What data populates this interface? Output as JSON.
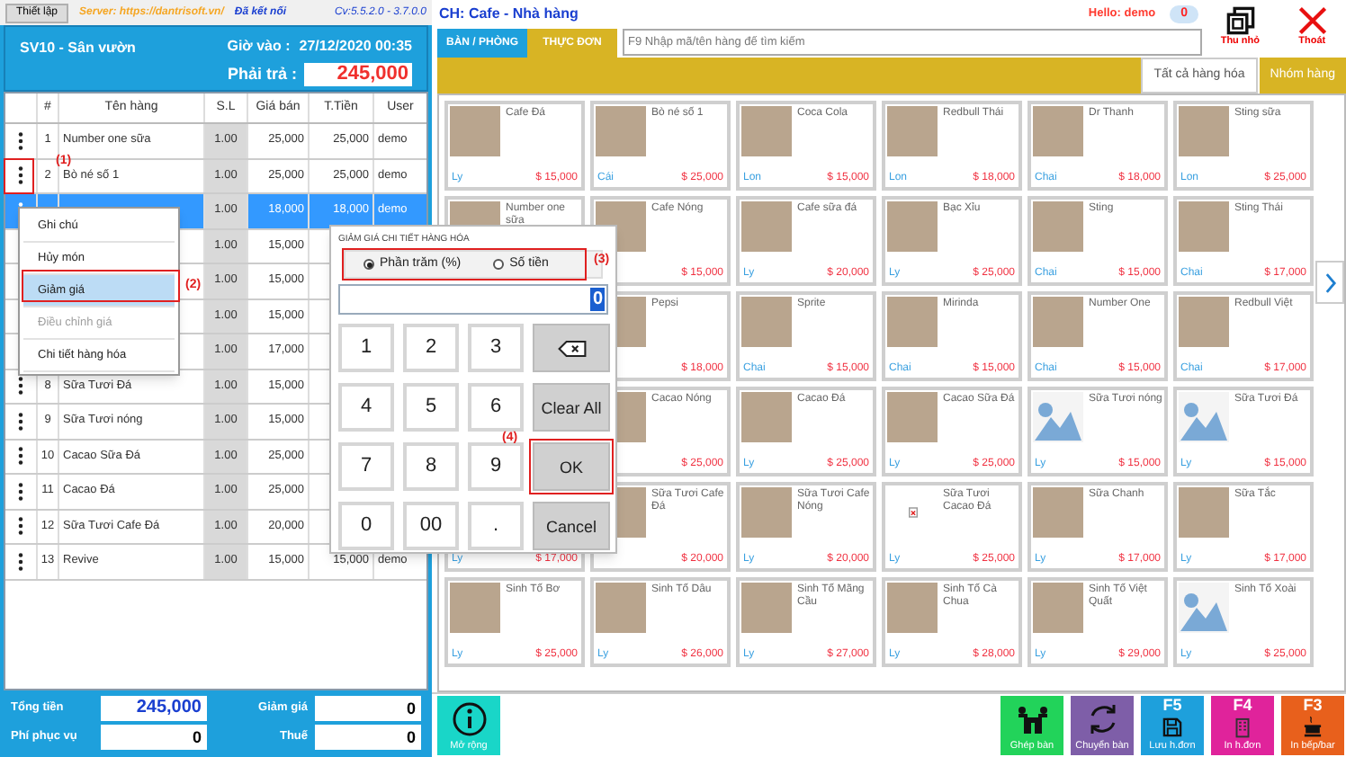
{
  "top_bar": {
    "settings_button": "Thiết lập",
    "server": "Server: https://dantrisoft.vn/",
    "connection": "Đã kết nối",
    "version": "Cv:5.5.2.0 - 3.7.0.0"
  },
  "order_header": {
    "table": "SV10 - Sân vườn",
    "time_label": "Giờ vào :",
    "time": "27/12/2020 00:35",
    "due_label": "Phải trả :",
    "due": "245,000"
  },
  "order_table": {
    "columns": [
      "#",
      "Tên hàng",
      "S.L",
      "Giá bán",
      "T.Tiền",
      "User"
    ],
    "rows": [
      {
        "number": "1",
        "name": "Number one sữa",
        "qty": "1.00",
        "price": "25,000",
        "total": "25,000",
        "user": "demo",
        "selected": false
      },
      {
        "number": "2",
        "name": "Bò né số 1",
        "qty": "1.00",
        "price": "25,000",
        "total": "25,000",
        "user": "demo",
        "selected": false
      },
      {
        "qty": "1.00",
        "price": "18,000",
        "total": "18,000",
        "user": "demo",
        "selected": true
      },
      {
        "qty": "1.00",
        "price": "15,000",
        "selected": false
      },
      {
        "qty": "1.00",
        "price": "15,000",
        "selected": false
      },
      {
        "qty": "1.00",
        "price": "15,000",
        "selected": false
      },
      {
        "qty": "1.00",
        "price": "17,000",
        "selected": false
      },
      {
        "number": "8",
        "name": "Sữa Tươi Đá",
        "qty": "1.00",
        "price": "15,000",
        "selected": false
      },
      {
        "number": "9",
        "name": "Sữa Tươi nóng",
        "qty": "1.00",
        "price": "15,000",
        "selected": false
      },
      {
        "number": "10",
        "name": "Cacao Sữa Đá",
        "qty": "1.00",
        "price": "25,000",
        "selected": false
      },
      {
        "number": "11",
        "name": "Cacao Đá",
        "qty": "1.00",
        "price": "25,000",
        "selected": false
      },
      {
        "number": "12",
        "name": "Sữa Tươi Cafe Đá",
        "qty": "1.00",
        "price": "20,000",
        "selected": false
      },
      {
        "number": "13",
        "name": "Revive",
        "qty": "1.00",
        "price": "15,000",
        "total": "15,000",
        "user": "demo",
        "selected": false
      }
    ]
  },
  "totals": [
    {
      "label": "Tổng tiền",
      "value": "245,000",
      "highlighted": true
    },
    {
      "label": "Giảm giá",
      "value": "0",
      "highlighted": false
    },
    {
      "label": "Phí phục vụ",
      "value": "0",
      "highlighted": false
    },
    {
      "label": "Thuế",
      "value": "0",
      "highlighted": false
    }
  ],
  "context_menu": [
    {
      "label": "Ghi chú",
      "selected": false,
      "disabled": false
    },
    {
      "label": "Hủy món",
      "selected": false,
      "disabled": false
    },
    {
      "label": "Giảm giá",
      "selected": true,
      "disabled": false
    },
    {
      "label": "Điều chỉnh giá",
      "selected": false,
      "disabled": true
    },
    {
      "label": "Chi tiết hàng hóa",
      "selected": false,
      "disabled": false
    }
  ],
  "discount_dialog": {
    "title": "GIẢM GIÁ CHI TIẾT HÀNG HÓA",
    "modes": [
      {
        "label": "Phần trăm (%)",
        "selected": true
      },
      {
        "label": "Số tiền",
        "selected": false
      }
    ],
    "value": "0",
    "keys": [
      {
        "kind": "digit",
        "label": "1"
      },
      {
        "kind": "digit",
        "label": "2"
      },
      {
        "kind": "digit",
        "label": "3"
      },
      {
        "kind": "backspace"
      },
      {
        "kind": "digit",
        "label": "4"
      },
      {
        "kind": "digit",
        "label": "5"
      },
      {
        "kind": "digit",
        "label": "6"
      },
      {
        "kind": "action",
        "label": "Clear All"
      },
      {
        "kind": "digit",
        "label": "7"
      },
      {
        "kind": "digit",
        "label": "8"
      },
      {
        "kind": "digit",
        "label": "9"
      },
      {
        "kind": "action",
        "label": "OK"
      },
      {
        "kind": "digit",
        "label": "0"
      },
      {
        "kind": "digit",
        "label": "00"
      },
      {
        "kind": "digit",
        "label": "."
      },
      {
        "kind": "action",
        "label": "Cancel"
      }
    ]
  },
  "annotations": [
    {
      "kind": "row_menu",
      "label": "(1)"
    },
    {
      "kind": "menu_item",
      "label": "(2)"
    },
    {
      "kind": "mode",
      "label": "(3)"
    },
    {
      "kind": "ok_key",
      "label": "(4)"
    }
  ],
  "store": {
    "title": "CH: Cafe - Nhà hàng",
    "greeting": "Hello: demo",
    "notifications": "0"
  },
  "window_buttons": [
    {
      "kind": "minimize",
      "label": "Thu nhỏ"
    },
    {
      "kind": "exit",
      "label": "Thoát"
    }
  ],
  "tabs": [
    {
      "label": "BÀN / PHÒNG",
      "selected": false
    },
    {
      "label": "THỰC ĐƠN",
      "selected": true
    }
  ],
  "search": {
    "placeholder": "F9 Nhập mã/tên hàng để tìm kiếm"
  },
  "filters": [
    {
      "label": "Tất cả hàng hóa",
      "selected": true
    },
    {
      "label": "Nhóm hàng",
      "selected": false
    }
  ],
  "product_rows": [
    {
      "items": [
        {
          "name": "Cafe Đá",
          "unit": "Ly",
          "price": "$ 15,000",
          "kind": "photo"
        },
        {
          "name": "Bò né số 1",
          "unit": "Cái",
          "price": "$ 25,000",
          "kind": "photo"
        },
        {
          "name": "Coca Cola",
          "unit": "Lon",
          "price": "$ 15,000",
          "kind": "photo"
        },
        {
          "name": "Redbull Thái",
          "unit": "Lon",
          "price": "$ 18,000",
          "kind": "photo"
        },
        {
          "name": "Dr Thanh",
          "unit": "Chai",
          "price": "$ 18,000",
          "kind": "photo"
        },
        {
          "name": "Sting sữa",
          "unit": "Lon",
          "price": "$ 25,000",
          "kind": "photo"
        }
      ]
    },
    {
      "items": [
        {
          "name": "Number one sữa",
          "kind": "photo"
        },
        {
          "name": "Cafe Nóng",
          "price": "$ 15,000",
          "kind": "photo"
        },
        {
          "name": "Cafe sữa đá",
          "unit": "Ly",
          "price": "$ 20,000",
          "kind": "photo"
        },
        {
          "name": "Bạc Xỉu",
          "unit": "Ly",
          "price": "$ 25,000",
          "kind": "photo"
        },
        {
          "name": "Sting",
          "unit": "Chai",
          "price": "$ 15,000",
          "kind": "photo"
        },
        {
          "name": "Sting Thái",
          "unit": "Chai",
          "price": "$ 17,000",
          "kind": "photo"
        }
      ]
    },
    {
      "items": [
        {
          "name": "Pepsi",
          "price": "$ 18,000",
          "kind": "photo"
        },
        {
          "name": "Sprite",
          "unit": "Chai",
          "price": "$ 15,000",
          "kind": "photo"
        },
        {
          "name": "Mirinda",
          "unit": "Chai",
          "price": "$ 15,000",
          "kind": "photo"
        },
        {
          "name": "Number One",
          "unit": "Chai",
          "price": "$ 15,000",
          "kind": "photo"
        },
        {
          "name": "Redbull Việt",
          "unit": "Chai",
          "price": "$ 17,000",
          "kind": "photo"
        }
      ]
    },
    {
      "items": [
        {
          "name": "Cacao Nóng",
          "price": "$ 25,000",
          "kind": "photo"
        },
        {
          "name": "Cacao Đá",
          "unit": "Ly",
          "price": "$ 25,000",
          "kind": "photo"
        },
        {
          "name": "Cacao Sữa Đá",
          "unit": "Ly",
          "price": "$ 25,000",
          "kind": "photo"
        },
        {
          "name": "Sữa Tươi nóng",
          "unit": "Ly",
          "price": "$ 15,000",
          "kind": "placeholder"
        },
        {
          "name": "Sữa Tươi Đá",
          "unit": "Ly",
          "price": "$ 15,000",
          "kind": "placeholder"
        }
      ]
    },
    {
      "items": [
        {
          "unit": "Ly",
          "price": "$ 17,000"
        },
        {
          "name": "Sữa Tươi Cafe Đá",
          "price": "$ 20,000",
          "kind": "photo"
        },
        {
          "name": "Sữa Tươi Cafe Nóng",
          "unit": "Ly",
          "price": "$ 20,000",
          "kind": "photo"
        },
        {
          "name": "Sữa Tươi Cacao Đá",
          "unit": "Ly",
          "price": "$ 25,000",
          "kind": "broken"
        },
        {
          "name": "Sữa Chanh",
          "unit": "Ly",
          "price": "$ 17,000",
          "kind": "photo"
        },
        {
          "name": "Sữa Tắc",
          "unit": "Ly",
          "price": "$ 17,000",
          "kind": "photo"
        }
      ]
    },
    {
      "items": [
        {
          "name": "Sinh Tố Bơ",
          "unit": "Ly",
          "price": "$ 25,000",
          "kind": "photo"
        },
        {
          "name": "Sinh Tố Dâu",
          "unit": "Ly",
          "price": "$ 26,000",
          "kind": "photo"
        },
        {
          "name": "Sinh Tố Mãng Cầu",
          "unit": "Ly",
          "price": "$ 27,000",
          "kind": "photo"
        },
        {
          "name": "Sinh Tố Cà Chua",
          "unit": "Ly",
          "price": "$ 28,000",
          "kind": "photo"
        },
        {
          "name": "Sinh Tố Việt Quất",
          "unit": "Ly",
          "price": "$ 29,000",
          "kind": "photo"
        },
        {
          "name": "Sinh Tố Xoài",
          "unit": "Ly",
          "price": "$ 25,000",
          "kind": "placeholder"
        }
      ]
    }
  ],
  "actions": [
    {
      "kind": "info",
      "label": "Mở rộng",
      "color": "#19d6c8"
    },
    {
      "kind": "merge",
      "label": "Ghép bàn",
      "color": "#22d35a"
    },
    {
      "kind": "move",
      "label": "Chuyển bàn",
      "color": "#7e5ea8"
    },
    {
      "kind": "save",
      "key": "F5",
      "label": "Lưu h.đơn",
      "color": "#1ea0dc"
    },
    {
      "kind": "print",
      "key": "F4",
      "label": "In h.đơn",
      "color": "#e0239b"
    },
    {
      "kind": "kitchen",
      "key": "F3",
      "label": "In bếp/bar",
      "color": "#e8601c"
    }
  ]
}
